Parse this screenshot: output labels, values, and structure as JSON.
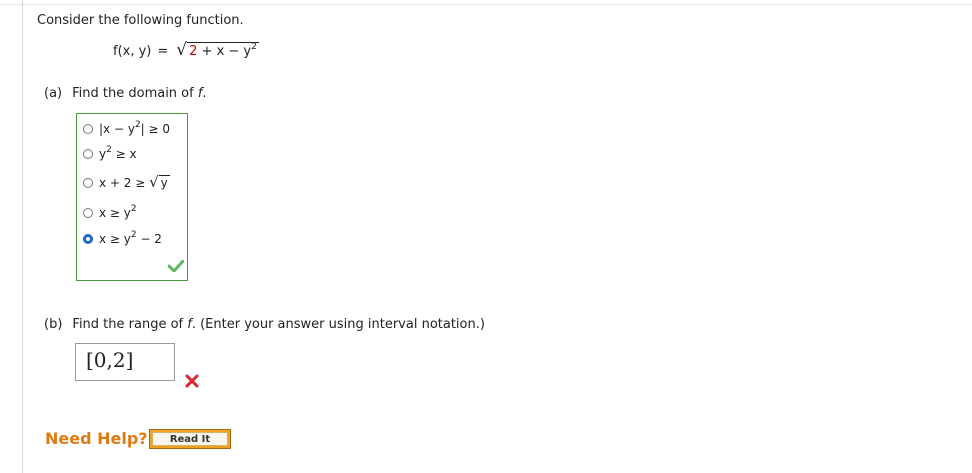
{
  "prompt": "Consider the following function.",
  "formula": {
    "lhs": "f(x, y)",
    "eq": "=",
    "radicand_red": "2",
    "radicand_rest": " + x − y",
    "exponent": "2"
  },
  "part_a": {
    "letter": "(a)",
    "question_prefix": "Find the domain of ",
    "question_var": "f",
    "question_suffix": ".",
    "choices": [
      {
        "base": "|x − y",
        "exp": "2",
        "tail": "| ≥ 0",
        "selected": false
      },
      {
        "base": "y",
        "exp": "2",
        "tail": " ≥ x",
        "selected": false
      },
      {
        "base": "x + 2 ≥ ",
        "sqrt": "y",
        "selected": false
      },
      {
        "base": "x ≥ y",
        "exp": "2",
        "tail": "",
        "selected": false
      },
      {
        "base": "x ≥ y",
        "exp": "2",
        "tail": " − 2",
        "selected": true
      }
    ],
    "result": "correct"
  },
  "part_b": {
    "letter": "(b)",
    "question_prefix": "Find the range of ",
    "question_var": "f",
    "question_suffix": ". (Enter your answer using interval notation.)",
    "answer": "[0,2]",
    "result": "incorrect"
  },
  "help": {
    "label": "Need Help?",
    "read_it_label": "Read It"
  },
  "colors": {
    "correct_green": "#5cb85c",
    "incorrect_red": "#e0262e",
    "help_orange": "#e07a12",
    "box_green": "#4a9a3c"
  }
}
